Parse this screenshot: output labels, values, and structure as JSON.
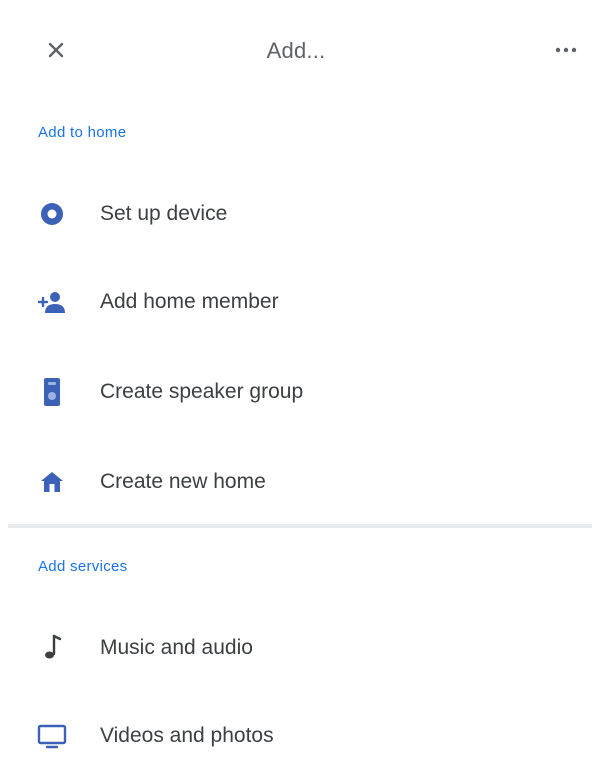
{
  "header": {
    "title": "Add...",
    "close_icon": "close-icon",
    "more_icon": "more-horizontal-icon"
  },
  "sections": [
    {
      "header": "Add to home",
      "items": [
        {
          "label": "Set up device",
          "icon": "device-setup-icon"
        },
        {
          "label": "Add home member",
          "icon": "person-add-icon"
        },
        {
          "label": "Create speaker group",
          "icon": "speaker-group-icon"
        },
        {
          "label": "Create new home",
          "icon": "home-icon"
        }
      ]
    },
    {
      "header": "Add services",
      "items": [
        {
          "label": "Music and audio",
          "icon": "music-note-icon"
        },
        {
          "label": "Videos and photos",
          "icon": "monitor-icon"
        }
      ]
    }
  ],
  "colors": {
    "accent": "#1a73e8",
    "icon": "#3c62b8",
    "text": "#3c4043",
    "divider": "#e8eaed"
  }
}
